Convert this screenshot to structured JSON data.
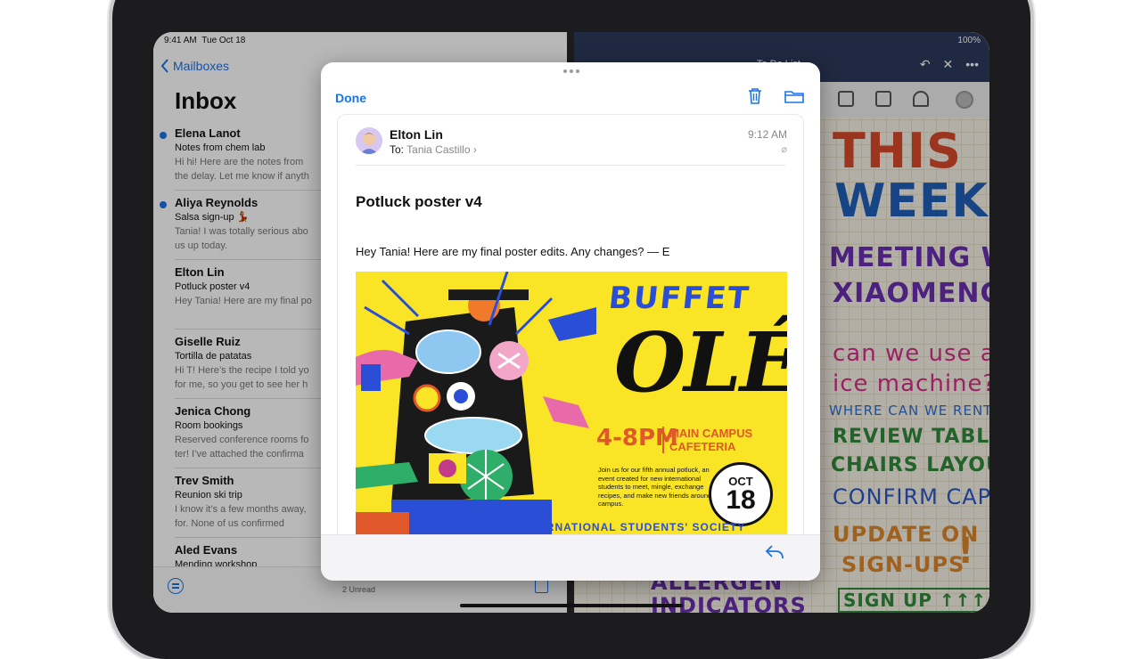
{
  "status": {
    "time": "9:41 AM",
    "date": "Tue Oct 18",
    "battery": "100%"
  },
  "mail_nav": {
    "back_label": "Mailboxes",
    "title": "Inbox"
  },
  "mail_list": [
    {
      "sender": "Elena Lanot",
      "subject": "Notes from chem lab",
      "preview1": "Hi hi! Here are the notes from",
      "preview2": "the delay. Let me know if anyth",
      "unread": true
    },
    {
      "sender": "Aliya Reynolds",
      "subject": "Salsa sign-up 💃",
      "preview1": "Tania! I was totally serious abo",
      "preview2": "us up today.",
      "unread": true
    },
    {
      "sender": "Elton Lin",
      "subject": "Potluck poster v4",
      "preview1": "Hey Tania! Here are my final po",
      "preview2": "",
      "unread": false
    },
    {
      "sender": "Giselle Ruiz",
      "subject": "Tortilla de patatas",
      "preview1": "Hi T! Here’s the recipe I told yo",
      "preview2": "for me, so you get to see her h",
      "unread": false
    },
    {
      "sender": "Jenica Chong",
      "subject": "Room bookings",
      "preview1": "Reserved conference rooms fo",
      "preview2": "ter! I’ve attached the confirma",
      "unread": false
    },
    {
      "sender": "Trev Smith",
      "subject": "Reunion ski trip",
      "preview1": "I know it’s a few months away,",
      "preview2": "for. None of us confirmed",
      "unread": false
    },
    {
      "sender": "Aled Evans",
      "subject": "Mending workshop",
      "preview1": "",
      "preview2": "",
      "unread": false
    }
  ],
  "mail_toolbar": {
    "unread_count": "2 Unread"
  },
  "notes": {
    "title": "To Do List",
    "lines": [
      "THIS",
      "WEEK",
      "MEETING WITH",
      "XIAOMENG",
      "can we use an",
      "ice machine?",
      "WHERE CAN WE RENT ONE?",
      "REVIEW TABLE/",
      "CHAIRS LAYOUT",
      "CONFIRM CAPACITY",
      "UPDATE ON",
      "SIGN-UPS",
      "!",
      "SIGN UP ↑↑↑",
      "ALLERGEN",
      "INDICATORS"
    ]
  },
  "message": {
    "done_label": "Done",
    "sender": "Elton Lin",
    "to_label": "To:",
    "recipient": "Tania Castillo",
    "time": "9:12 AM",
    "subject": "Potluck poster v4",
    "body": "Hey Tania! Here are my final poster edits. Any changes? — E"
  },
  "poster": {
    "title1": "BUFFET",
    "title2": "OLÉ",
    "time": "4-8PM",
    "venue1": "MAIN CAMPUS",
    "venue2": "CAFETERIA",
    "description": "Join us for our fifth annual potluck, an event created for new international students to meet, mingle, exchange recipes, and make new friends around campus.",
    "month": "OCT",
    "day": "18",
    "host": "HOSTED BY THE INTERNATIONAL STUDENTS' SOCIETY"
  },
  "colors": {
    "accent": "#1a73e8",
    "poster_yellow": "#f9e425",
    "poster_blue": "#2a4fd6",
    "poster_orange": "#e0582a"
  }
}
